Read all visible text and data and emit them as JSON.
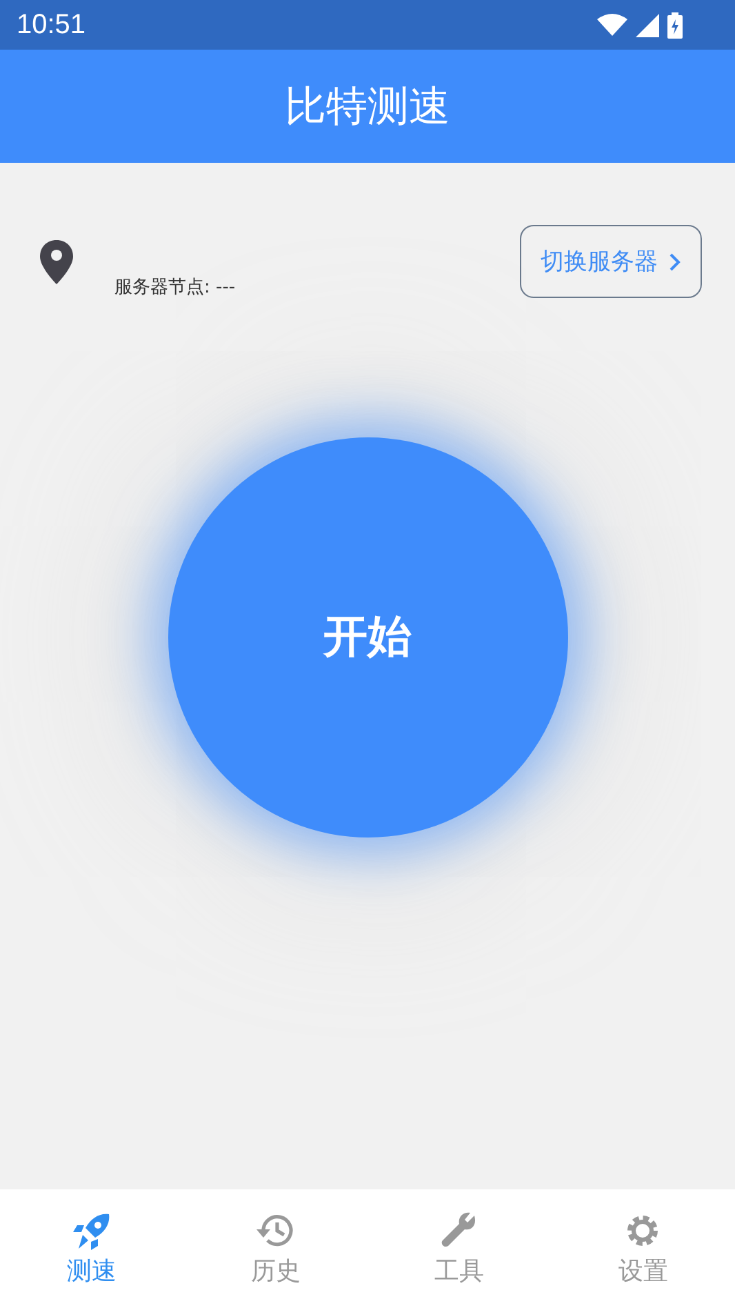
{
  "status_bar": {
    "time": "10:51"
  },
  "app_bar": {
    "title": "比特测速"
  },
  "server": {
    "label": "服务器节点: ---",
    "switch_button": "切换服务器"
  },
  "start_button": {
    "label": "开始"
  },
  "tabs": [
    {
      "kind": "speed",
      "label": "测速",
      "selected": true
    },
    {
      "kind": "history",
      "label": "历史",
      "selected": false
    },
    {
      "kind": "tools",
      "label": "工具",
      "selected": false
    },
    {
      "kind": "settings",
      "label": "设置",
      "selected": false
    }
  ]
}
